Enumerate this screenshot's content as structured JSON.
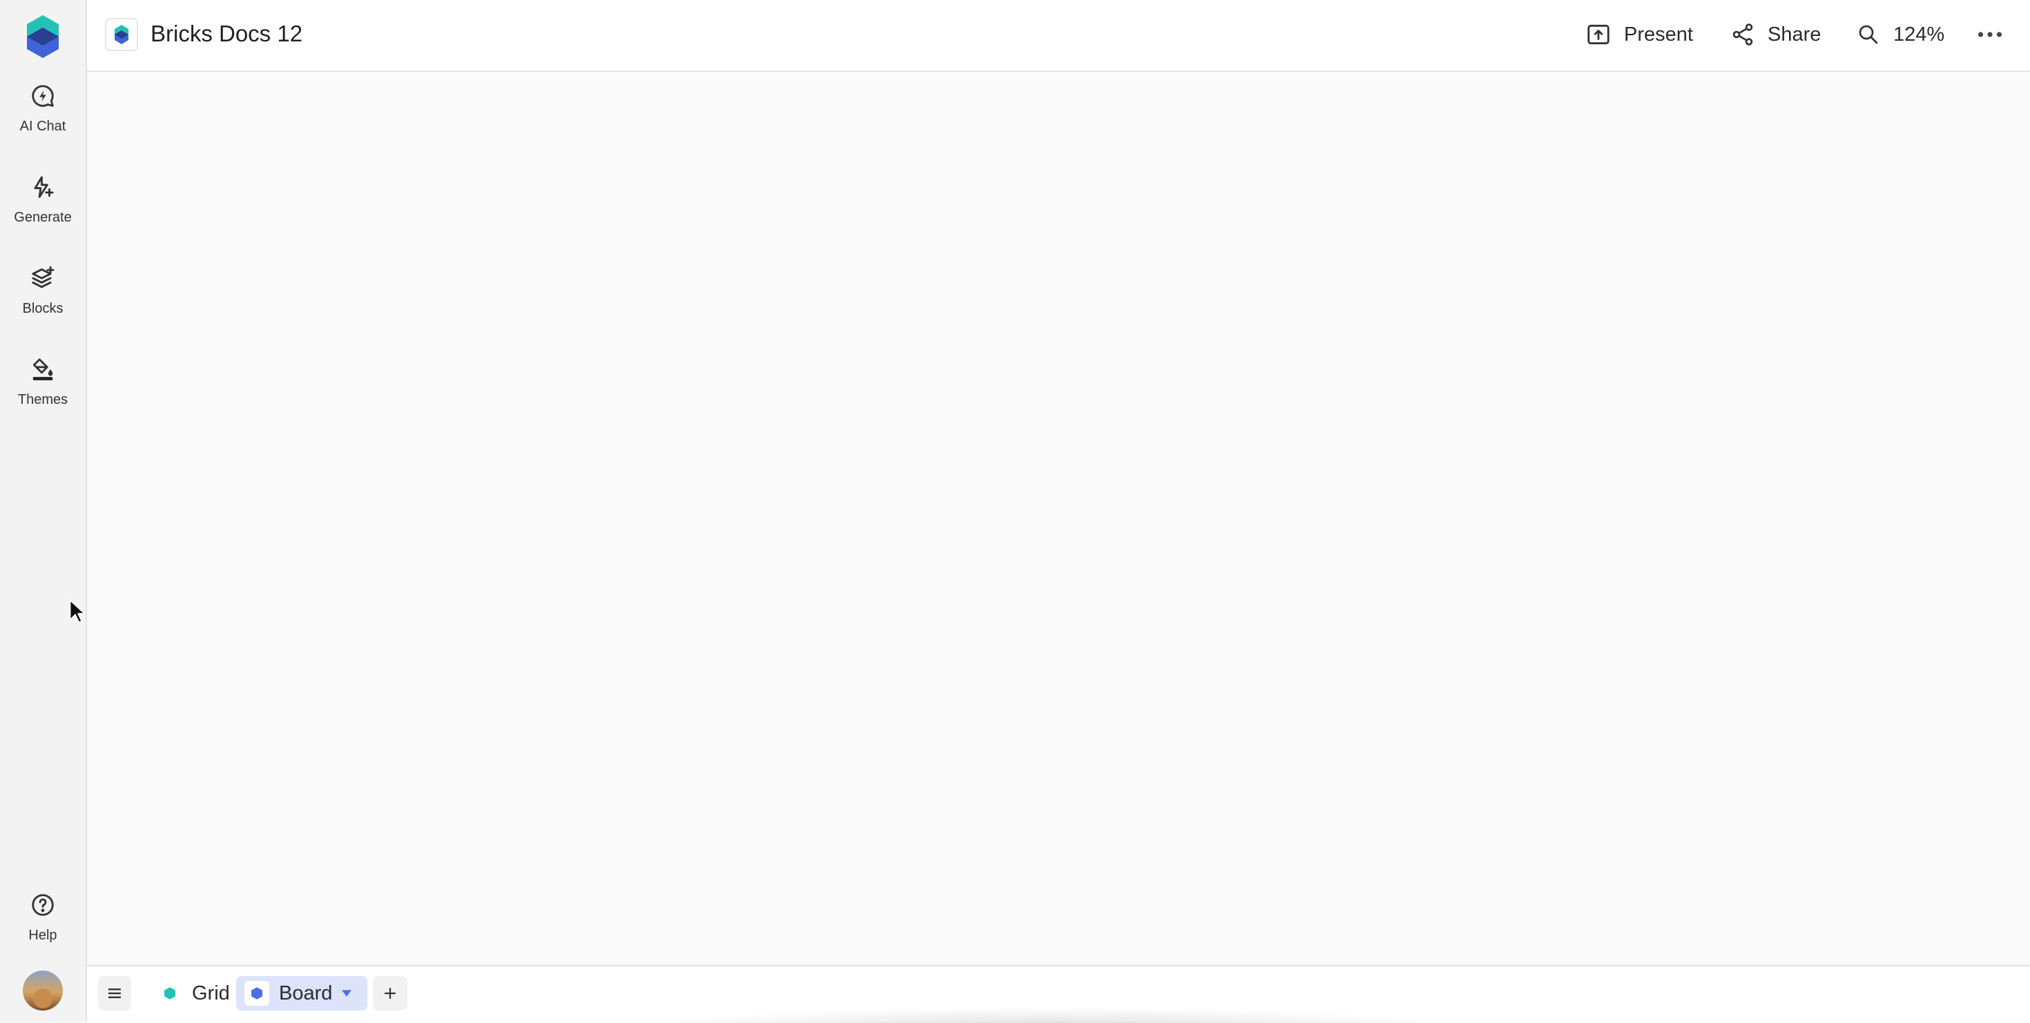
{
  "sidebar": {
    "items": [
      {
        "label": "AI Chat",
        "icon": "ai-chat-icon"
      },
      {
        "label": "Generate",
        "icon": "sparkle-icon"
      },
      {
        "label": "Blocks",
        "icon": "layers-plus-icon"
      },
      {
        "label": "Themes",
        "icon": "paint-bucket-icon"
      }
    ],
    "help_label": "Help"
  },
  "header": {
    "title": "Bricks Docs 12",
    "present_label": "Present",
    "share_label": "Share",
    "zoom_label": "124%"
  },
  "bottombar": {
    "tabs": [
      {
        "label": "Grid",
        "active": false
      },
      {
        "label": "Board",
        "active": true
      }
    ]
  },
  "colors": {
    "brand_teal": "#22c3b5",
    "brand_blue": "#3f63d8",
    "active_tab_bg": "#dce3fb"
  }
}
